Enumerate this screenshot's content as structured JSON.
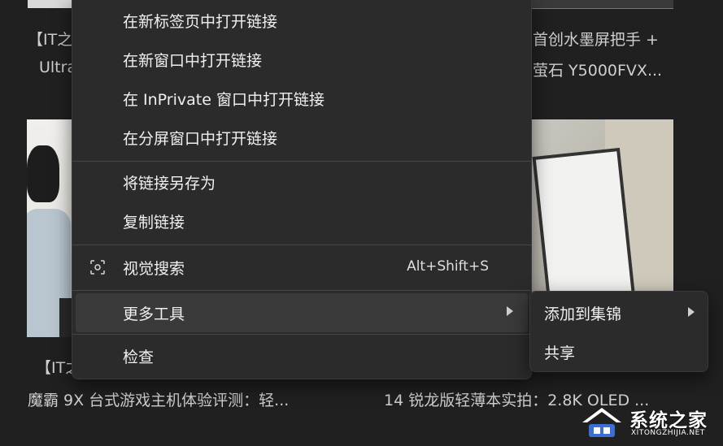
{
  "background": {
    "top_left_title": "【IT之",
    "top_left_subtitle": "Ultra",
    "top_right_title": "首创水墨屏把手 +",
    "top_right_subtitle": "萤石 Y5000FVX...",
    "bottom_left_title": "【IT之",
    "bottom_left_subtitle": "魔霸 9X 台式游戏主机体验评测：轻...",
    "bottom_right_subtitle": "14 锐龙版轻薄本实拍：2.8K OLED ..."
  },
  "menu": {
    "items": [
      {
        "label": "在新标签页中打开链接"
      },
      {
        "label": "在新窗口中打开链接"
      },
      {
        "label": "在 InPrivate 窗口中打开链接"
      },
      {
        "label": "在分屏窗口中打开链接"
      },
      {
        "label": "将链接另存为"
      },
      {
        "label": "复制链接"
      },
      {
        "label": "视觉搜索",
        "shortcut": "Alt+Shift+S",
        "icon": "visual-search-icon"
      },
      {
        "label": "更多工具",
        "icon": "chevron-right-icon"
      },
      {
        "label": "检查"
      }
    ]
  },
  "submenu": {
    "items": [
      {
        "label": "添加到集锦",
        "icon": "chevron-right-icon"
      },
      {
        "label": "共享"
      }
    ]
  },
  "watermark": {
    "title": "系统之家",
    "subtitle": "XITONGZHIJIA.NET"
  },
  "colors": {
    "menu_bg": "#2b2b2b",
    "hover_bg": "#3a3a3a",
    "page_bg": "#202020"
  }
}
